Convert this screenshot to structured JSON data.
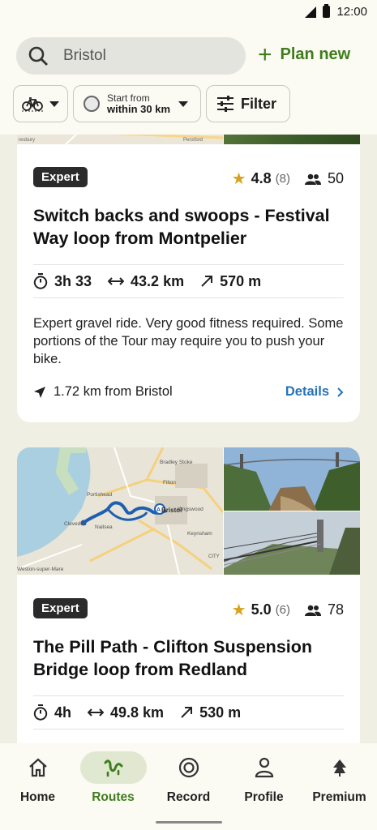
{
  "status": {
    "time": "12:00"
  },
  "search": {
    "value": "Bristol",
    "plan_new_label": "Plan new"
  },
  "filters": {
    "start_from_label": "Start from",
    "start_from_value": "within 30 km",
    "filter_label": "Filter"
  },
  "routes": [
    {
      "difficulty": "Expert",
      "rating": "4.8",
      "rating_count": "(8)",
      "riders": "50",
      "title": "Switch backs and swoops - Festival Way loop from Montpelier",
      "duration": "3h 33",
      "distance": "43.2 km",
      "elevation": "570 m",
      "description": "Expert gravel ride. Very good fitness required. Some portions of the Tour may require you to push your bike.",
      "distance_from": "1.72 km from Bristol",
      "details_label": "Details",
      "map_labels": [
        "resbury",
        "Pensford"
      ]
    },
    {
      "difficulty": "Expert",
      "rating": "5.0",
      "rating_count": "(6)",
      "riders": "78",
      "title": "The Pill Path - Clifton Suspension Bridge loop from Redland",
      "duration": "4h",
      "distance": "49.8 km",
      "elevation": "530 m",
      "map_labels": [
        "Bradley Stoke",
        "Filton",
        "Portishead",
        "Kingswood",
        "Clevedon",
        "Nailsea",
        "Keynsham",
        "CITY",
        "Weston-super-Mare",
        "Bristol"
      ]
    }
  ],
  "nav": {
    "items": [
      {
        "label": "Home",
        "icon": "home-icon"
      },
      {
        "label": "Routes",
        "icon": "routes-icon",
        "active": true
      },
      {
        "label": "Record",
        "icon": "record-icon"
      },
      {
        "label": "Profile",
        "icon": "profile-icon"
      },
      {
        "label": "Premium",
        "icon": "premium-icon"
      }
    ]
  },
  "colors": {
    "accent": "#3f7d1c",
    "link": "#2672b8",
    "star": "#d7a21d",
    "background": "#f0efe4"
  }
}
